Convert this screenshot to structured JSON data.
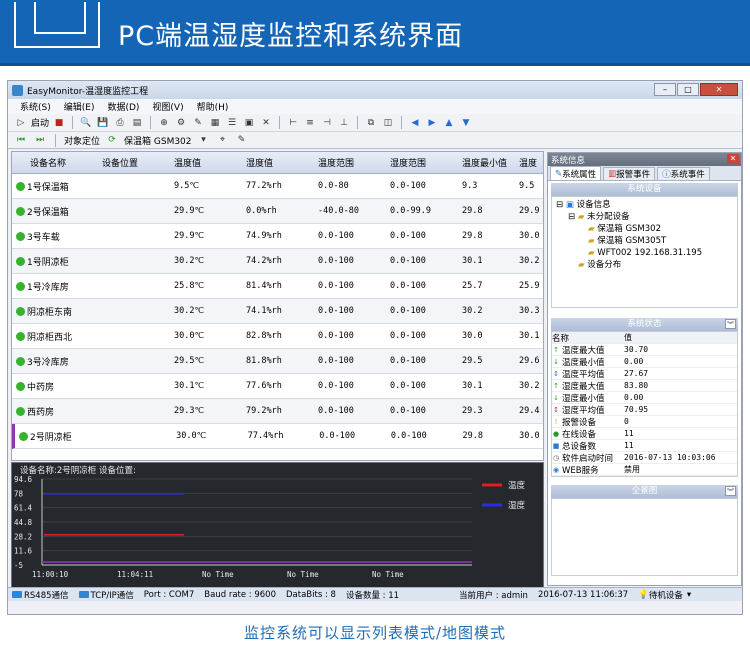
{
  "banner": {
    "title": "PC端温湿度监控和系统界面"
  },
  "window": {
    "title": "EasyMonitor-温湿度监控工程"
  },
  "menu": [
    "系统(S)",
    "编辑(E)",
    "数据(D)",
    "视图(V)",
    "帮助(H)"
  ],
  "toolbar": {
    "start_label": "启动",
    "locate_label": "对象定位",
    "selector_value": "保温箱 GSM302"
  },
  "table": {
    "columns": [
      "设备名称",
      "设备位置",
      "温度值",
      "湿度值",
      "温度范围",
      "湿度范围",
      "温度最小值",
      "温度"
    ],
    "rows": [
      {
        "name": "1号保温箱",
        "location": "",
        "temp": "9.5℃",
        "hum": "77.2%rh",
        "trange": "0.0-80",
        "hrange": "0.0-100",
        "tmin": "9.3",
        "tmax": "9.5"
      },
      {
        "name": "2号保温箱",
        "location": "",
        "temp": "29.9℃",
        "hum": "0.0%rh",
        "trange": "-40.0-80",
        "hrange": "0.0-99.9",
        "tmin": "29.8",
        "tmax": "29.9"
      },
      {
        "name": "3号车载",
        "location": "",
        "temp": "29.9℃",
        "hum": "74.9%rh",
        "trange": "0.0-100",
        "hrange": "0.0-100",
        "tmin": "29.8",
        "tmax": "30.0"
      },
      {
        "name": "1号阴凉柜",
        "location": "",
        "temp": "30.2℃",
        "hum": "74.2%rh",
        "trange": "0.0-100",
        "hrange": "0.0-100",
        "tmin": "30.1",
        "tmax": "30.2"
      },
      {
        "name": "1号冷库房",
        "location": "",
        "temp": "25.8℃",
        "hum": "81.4%rh",
        "trange": "0.0-100",
        "hrange": "0.0-100",
        "tmin": "25.7",
        "tmax": "25.9"
      },
      {
        "name": "阴凉柜东南",
        "location": "",
        "temp": "30.2℃",
        "hum": "74.1%rh",
        "trange": "0.0-100",
        "hrange": "0.0-100",
        "tmin": "30.2",
        "tmax": "30.3"
      },
      {
        "name": "阴凉柜西北",
        "location": "",
        "temp": "30.0℃",
        "hum": "82.8%rh",
        "trange": "0.0-100",
        "hrange": "0.0-100",
        "tmin": "30.0",
        "tmax": "30.1"
      },
      {
        "name": "3号冷库房",
        "location": "",
        "temp": "29.5℃",
        "hum": "81.8%rh",
        "trange": "0.0-100",
        "hrange": "0.0-100",
        "tmin": "29.5",
        "tmax": "29.6"
      },
      {
        "name": "中药房",
        "location": "",
        "temp": "30.1℃",
        "hum": "77.6%rh",
        "trange": "0.0-100",
        "hrange": "0.0-100",
        "tmin": "30.1",
        "tmax": "30.2"
      },
      {
        "name": "西药房",
        "location": "",
        "temp": "29.3℃",
        "hum": "79.2%rh",
        "trange": "0.0-100",
        "hrange": "0.0-100",
        "tmin": "29.3",
        "tmax": "29.4"
      },
      {
        "name": "2号阴凉柜",
        "location": "",
        "temp": "30.0℃",
        "hum": "77.4%rh",
        "trange": "0.0-100",
        "hrange": "0.0-100",
        "tmin": "29.8",
        "tmax": "30.0"
      }
    ]
  },
  "chart_data": {
    "type": "line",
    "title": "设备名称:2号阴凉柜  设备位置:",
    "x_ticks": [
      "11:00:10",
      "11:04:11",
      "No Time",
      "No Time",
      "No Time"
    ],
    "y_ticks": [
      94.6,
      78.0,
      61.4,
      44.8,
      28.2,
      11.6,
      -5.0
    ],
    "ylim": [
      -5.0,
      94.6
    ],
    "series": [
      {
        "name": "温度",
        "color": "#e02020",
        "x": [
          0,
          1
        ],
        "values": [
          30.0,
          30.0
        ]
      },
      {
        "name": "湿度",
        "color": "#2a2ae0",
        "x": [
          0,
          1
        ],
        "values": [
          77.4,
          77.4
        ]
      }
    ],
    "legend": "top-right"
  },
  "status": {
    "rs485": "RS485通信",
    "tcpip": "TCP/IP通信",
    "port": "Port : COM7",
    "baud": "Baud rate : 9600",
    "databits": "DataBits : 8",
    "count": "设备数量 : 11",
    "user": "当前用户 : admin",
    "time": "2016-07-13 11:06:37",
    "state": "待机设备"
  },
  "right": {
    "panel_title": "系统信息",
    "tabs": [
      "系统属性",
      "报警事件",
      "系统事件"
    ],
    "sec_devices": "系统设备",
    "tree": {
      "root": "设备信息",
      "group": "未分配设备",
      "items": [
        "保温箱 GSM302",
        "保温箱 GSM305T",
        "WFT002 192.168.31.195"
      ],
      "distribution": "设备分布"
    },
    "sec_status": "系统状态",
    "grid_head": {
      "k": "名称",
      "v": "值"
    },
    "grid": [
      {
        "k": "温度最大值",
        "v": "30.70",
        "i": "↑",
        "c": "#2a9a2a"
      },
      {
        "k": "温度最小值",
        "v": "0.00",
        "i": "↓",
        "c": "#2a9a2a"
      },
      {
        "k": "温度平均值",
        "v": "27.67",
        "i": "↕",
        "c": "#2a7ad0"
      },
      {
        "k": "湿度最大值",
        "v": "83.80",
        "i": "↑",
        "c": "#2a9a2a"
      },
      {
        "k": "湿度最小值",
        "v": "0.00",
        "i": "↓",
        "c": "#2a9a2a"
      },
      {
        "k": "湿度平均值",
        "v": "70.95",
        "i": "↕",
        "c": "#c03030"
      },
      {
        "k": "报警设备",
        "v": "0",
        "i": "!",
        "c": "#d0a020"
      },
      {
        "k": "在线设备",
        "v": "11",
        "i": "●",
        "c": "#2a9a2a"
      },
      {
        "k": "总设备数",
        "v": "11",
        "i": "■",
        "c": "#2a7ad0"
      },
      {
        "k": "软件启动时间",
        "v": "2016-07-13 10:03:06",
        "i": "◷",
        "c": "#555"
      },
      {
        "k": "WEB服务",
        "v": "禁用",
        "i": "◉",
        "c": "#2a7ad0"
      }
    ],
    "sec_overview": "全景图"
  },
  "footer": {
    "caption": "监控系统可以显示列表模式/地图模式"
  }
}
